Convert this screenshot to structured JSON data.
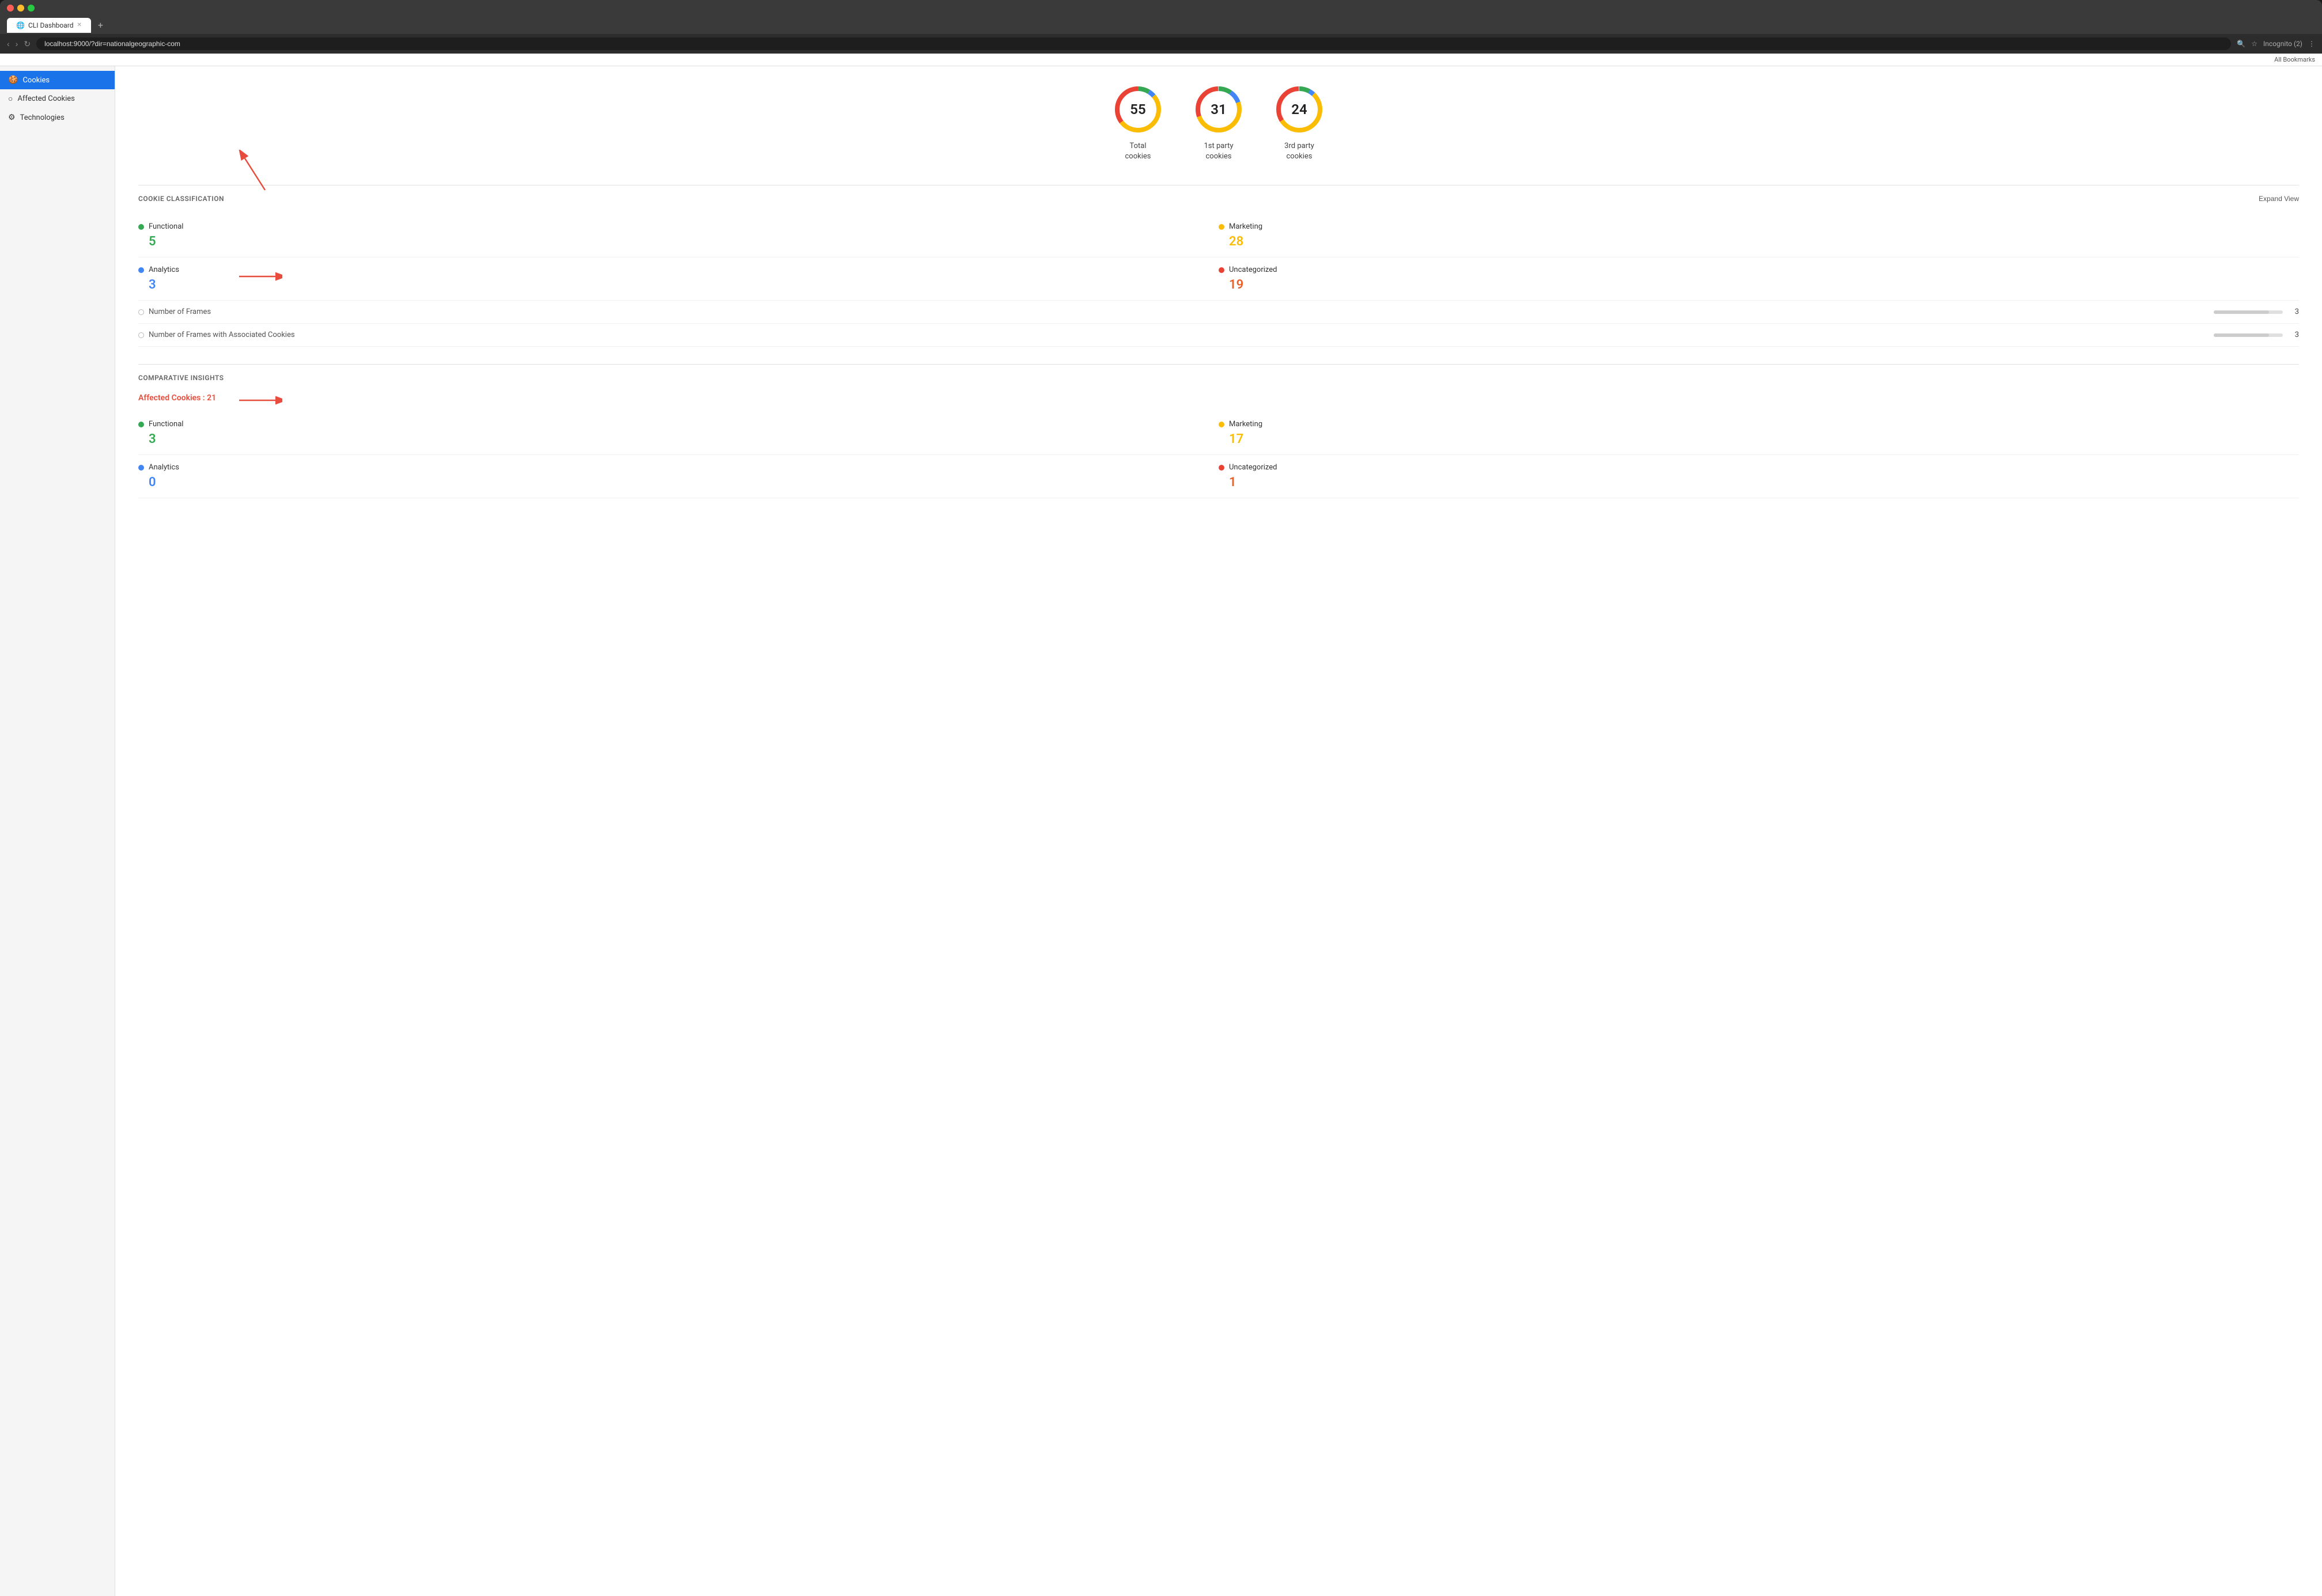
{
  "browser": {
    "tab_title": "CLI Dashboard",
    "url": "localhost:9000/?dir=nationalgeographic-com",
    "incognito_label": "Incognito (2)",
    "bookmarks_label": "All Bookmarks"
  },
  "sidebar": {
    "items": [
      {
        "id": "cookies",
        "label": "Cookies",
        "icon": "🍪",
        "active": true
      },
      {
        "id": "affected-cookies",
        "label": "Affected Cookies",
        "icon": "○",
        "active": false
      },
      {
        "id": "technologies",
        "label": "Technologies",
        "icon": "⚙",
        "active": false
      }
    ]
  },
  "stats": [
    {
      "id": "total",
      "value": "55",
      "label": "Total\ncookies",
      "color_segments": [
        {
          "color": "#34a853",
          "pct": 9
        },
        {
          "color": "#4285f4",
          "pct": 5
        },
        {
          "color": "#fbbc04",
          "pct": 51
        },
        {
          "color": "#ea4335",
          "pct": 35
        }
      ]
    },
    {
      "id": "first-party",
      "value": "31",
      "label": "1st party\ncookies",
      "color_segments": [
        {
          "color": "#34a853",
          "pct": 10
        },
        {
          "color": "#4285f4",
          "pct": 10
        },
        {
          "color": "#fbbc04",
          "pct": 50
        },
        {
          "color": "#ea4335",
          "pct": 30
        }
      ]
    },
    {
      "id": "third-party",
      "value": "24",
      "label": "3rd party\ncookies",
      "color_segments": [
        {
          "color": "#34a853",
          "pct": 8
        },
        {
          "color": "#4285f4",
          "pct": 4
        },
        {
          "color": "#fbbc04",
          "pct": 54
        },
        {
          "color": "#ea4335",
          "pct": 34
        }
      ]
    }
  ],
  "cookie_classification": {
    "section_title": "COOKIE CLASSIFICATION",
    "expand_label": "Expand View",
    "items": [
      {
        "id": "functional",
        "label": "Functional",
        "value": "5",
        "dot": "green",
        "value_color": "green"
      },
      {
        "id": "marketing",
        "label": "Marketing",
        "value": "28",
        "dot": "orange",
        "value_color": "orange"
      },
      {
        "id": "analytics",
        "label": "Analytics",
        "value": "3",
        "dot": "blue",
        "value_color": "blue"
      },
      {
        "id": "uncategorized",
        "label": "Uncategorized",
        "value": "19",
        "dot": "red",
        "value_color": "red-orange"
      }
    ],
    "frames": [
      {
        "id": "num-frames",
        "label": "Number of Frames",
        "value": "3",
        "bar_pct": 80
      },
      {
        "id": "num-frames-cookies",
        "label": "Number of Frames with Associated Cookies",
        "value": "3",
        "bar_pct": 80
      }
    ]
  },
  "comparative_insights": {
    "section_title": "COMPARATIVE INSIGHTS",
    "affected_label": "Affected Cookies : 21",
    "items": [
      {
        "id": "functional",
        "label": "Functional",
        "value": "3",
        "dot": "green",
        "value_color": "green"
      },
      {
        "id": "marketing",
        "label": "Marketing",
        "value": "17",
        "dot": "orange",
        "value_color": "orange"
      },
      {
        "id": "analytics",
        "label": "Analytics",
        "value": "0",
        "dot": "blue",
        "value_color": "blue"
      },
      {
        "id": "uncategorized",
        "label": "Uncategorized",
        "value": "1",
        "dot": "red",
        "value_color": "red-orange"
      }
    ]
  }
}
